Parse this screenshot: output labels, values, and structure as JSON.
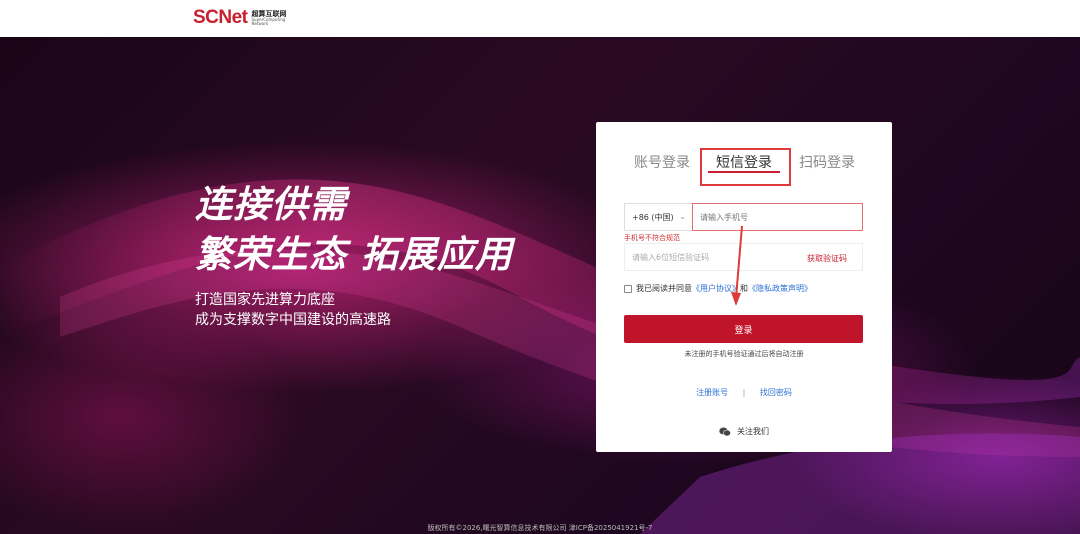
{
  "header": {
    "logo_text": "SCNet",
    "logo_cn": "超算互联网",
    "logo_en_line1": "SuperComputing",
    "logo_en_line2": "Network"
  },
  "hero": {
    "slogan_line1": "连接供需",
    "slogan_line2": "繁荣生态 拓展应用",
    "subline1": "打造国家先进算力底座",
    "subline2": "成为支撑数字中国建设的高速路"
  },
  "login": {
    "tabs": [
      {
        "label": "账号登录",
        "active": false
      },
      {
        "label": "短信登录",
        "active": true
      },
      {
        "label": "扫码登录",
        "active": false
      }
    ],
    "country_code": "+86 (中国)",
    "phone_placeholder": "请输入手机号",
    "phone_error": "手机号不符合规范",
    "code_placeholder": "请输入6位短信验证码",
    "get_code_label": "获取验证码",
    "agree_prefix": "我已阅读并同意",
    "user_agreement": "《用户协议》",
    "and": "和",
    "privacy_policy": "《隐私政策声明》",
    "submit_label": "登录",
    "note": "未注册的手机号验证通过后将自动注册",
    "register_label": "注册账号",
    "divider": "|",
    "forgot_label": "找回密码",
    "follow_label": "关注我们"
  },
  "footer": {
    "copyright": "版权所有©2026,曙光智算信息技术有限公司 津ICP备2025041921号-7"
  },
  "colors": {
    "brand": "#c8202f",
    "link": "#2a6fd6",
    "annotation": "#e03b3b"
  }
}
